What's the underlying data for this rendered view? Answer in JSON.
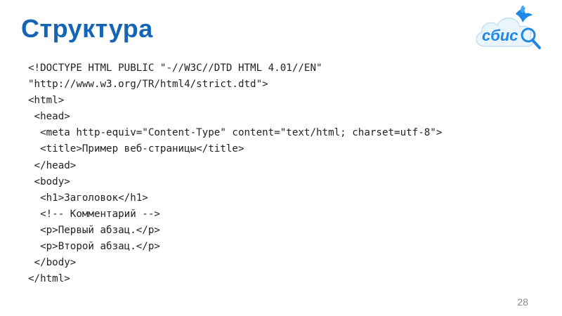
{
  "slide": {
    "title": "Структура",
    "page_number": "28"
  },
  "logo": {
    "text": "сбис",
    "icon": "cloud-bird-magnifier-logo"
  },
  "code_lines": [
    "<!DOCTYPE HTML PUBLIC \"-//W3C//DTD HTML 4.01//EN\"",
    "\"http://www.w3.org/TR/html4/strict.dtd\">",
    "<html>",
    " <head>",
    "  <meta http-equiv=\"Content-Type\" content=\"text/html; charset=utf-8\">",
    "  <title>Пример веб-страницы</title>",
    " </head>",
    " <body>",
    "  <h1>Заголовок</h1>",
    "  <!-- Комментарий -->",
    "  <p>Первый абзац.</p>",
    "  <p>Второй абзац.</p>",
    " </body>",
    "</html>"
  ],
  "colors": {
    "title": "#1565b5",
    "logo_blue": "#1e88e5",
    "logo_orange": "#f39200",
    "code_text": "#222222",
    "page_number": "#888888"
  }
}
